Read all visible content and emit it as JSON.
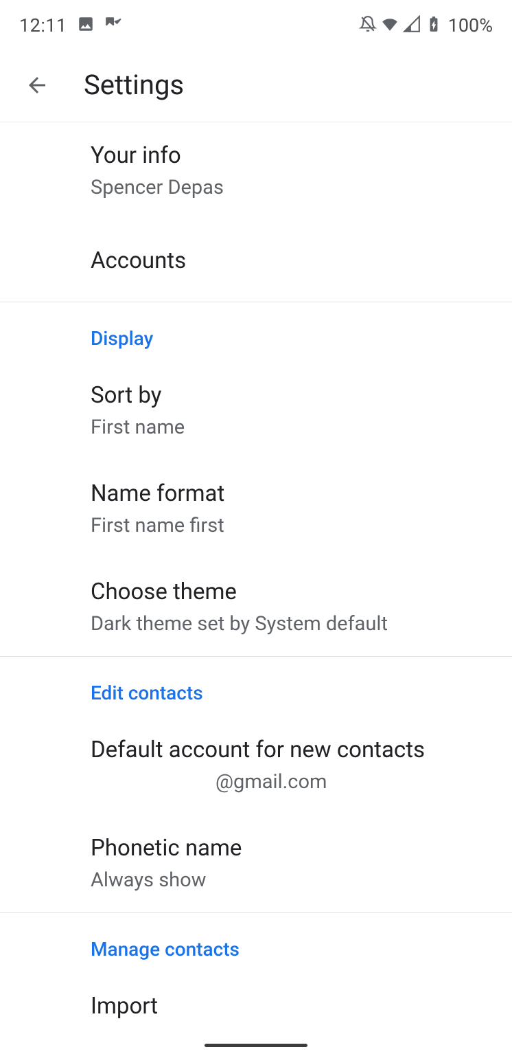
{
  "status_bar": {
    "time": "12:11",
    "battery_text": "100%"
  },
  "app_bar": {
    "title": "Settings"
  },
  "items": {
    "your_info": {
      "title": "Your info",
      "subtitle": "Spencer Depas"
    },
    "accounts": {
      "title": "Accounts"
    },
    "sort_by": {
      "title": "Sort by",
      "subtitle": "First name"
    },
    "name_format": {
      "title": "Name format",
      "subtitle": "First name first"
    },
    "choose_theme": {
      "title": "Choose theme",
      "subtitle": "Dark theme set by System default"
    },
    "default_account": {
      "title": "Default account for new contacts",
      "subtitle": "@gmail.com"
    },
    "phonetic_name": {
      "title": "Phonetic name",
      "subtitle": "Always show"
    },
    "import": {
      "title": "Import"
    }
  },
  "sections": {
    "display": "Display",
    "edit_contacts": "Edit contacts",
    "manage_contacts": "Manage contacts"
  }
}
